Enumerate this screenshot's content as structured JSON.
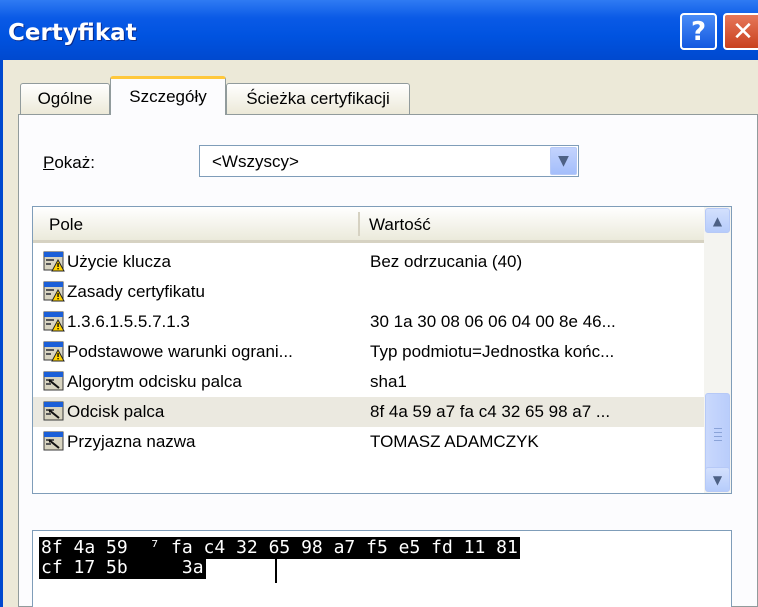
{
  "window": {
    "title": "Certyfikat",
    "help_label": "?",
    "close_label": "✕"
  },
  "tabs": [
    {
      "label": "Ogólne",
      "active": false
    },
    {
      "label": "Szczegóły",
      "active": true
    },
    {
      "label": "Ścieżka certyfikacji",
      "active": false
    }
  ],
  "show": {
    "label_prefix": "P",
    "label_rest": "okaż:",
    "value": "<Wszyscy>"
  },
  "list": {
    "columns": {
      "field": "Pole",
      "value": "Wartość"
    },
    "rows": [
      {
        "name": "Użycie klucza",
        "value": "Bez odrzucania (40)",
        "icon": "extension-warning-icon",
        "selected": false
      },
      {
        "name": "Zasady certyfikatu",
        "value": "",
        "icon": "extension-warning-icon",
        "selected": false
      },
      {
        "name": "1.3.6.1.5.5.7.1.3",
        "value": "30 1a 30 08 06 06 04 00 8e 46...",
        "icon": "extension-warning-icon",
        "selected": false
      },
      {
        "name": "Podstawowe warunki ograni...",
        "value": "Typ podmiotu=Jednostka końc...",
        "icon": "extension-warning-icon",
        "selected": false
      },
      {
        "name": "Algorytm odcisku palca",
        "value": "sha1",
        "icon": "property-icon",
        "selected": false
      },
      {
        "name": "Odcisk palca",
        "value": "8f 4a 59 a7 fa c4 32 65 98 a7 ...",
        "icon": "property-icon",
        "selected": true
      },
      {
        "name": "Przyjazna nazwa",
        "value": "TOMASZ  ADAMCZYK",
        "icon": "property-icon",
        "selected": false
      }
    ]
  },
  "value_box": {
    "line1": "8f 4a 59  ⁷ fa c4 32 65 98 a7 f5 e5 fd 11 81",
    "line2": "cf 17 5b     3a"
  },
  "colors": {
    "titlebar": "#0053e0",
    "dialog_bg": "#ece9d8",
    "active_tab_accent": "#ffc83c",
    "selected_row": "#ebe9e0"
  }
}
